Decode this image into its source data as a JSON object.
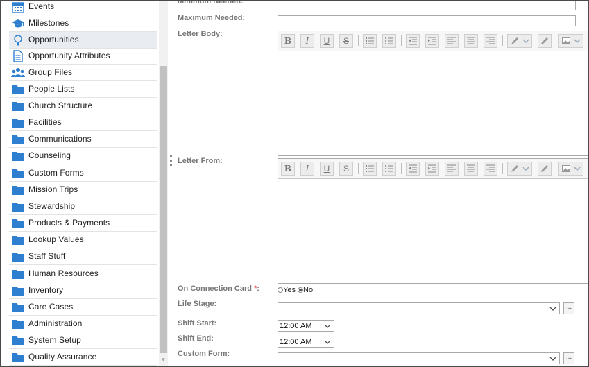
{
  "sidebar": {
    "items": [
      {
        "label": "Events",
        "icon": "calendar-icon"
      },
      {
        "label": "Milestones",
        "icon": "graduation-cap-icon"
      },
      {
        "label": "Opportunities",
        "icon": "lightbulb-icon",
        "active": true
      },
      {
        "label": "Opportunity Attributes",
        "icon": "document-icon"
      },
      {
        "label": "Group Files",
        "icon": "people-group-icon"
      },
      {
        "label": "People Lists",
        "icon": "folder-icon"
      },
      {
        "label": "Church Structure",
        "icon": "folder-icon"
      },
      {
        "label": "Facilities",
        "icon": "folder-icon"
      },
      {
        "label": "Communications",
        "icon": "folder-icon"
      },
      {
        "label": "Counseling",
        "icon": "folder-icon"
      },
      {
        "label": "Custom Forms",
        "icon": "folder-icon"
      },
      {
        "label": "Mission Trips",
        "icon": "folder-icon"
      },
      {
        "label": "Stewardship",
        "icon": "folder-icon"
      },
      {
        "label": "Products & Payments",
        "icon": "folder-icon"
      },
      {
        "label": "Lookup Values",
        "icon": "folder-icon"
      },
      {
        "label": "Staff Stuff",
        "icon": "folder-icon"
      },
      {
        "label": "Human Resources",
        "icon": "folder-icon"
      },
      {
        "label": "Inventory",
        "icon": "folder-icon"
      },
      {
        "label": "Care Cases",
        "icon": "folder-icon"
      },
      {
        "label": "Administration",
        "icon": "folder-icon"
      },
      {
        "label": "System Setup",
        "icon": "folder-icon"
      },
      {
        "label": "Quality Assurance",
        "icon": "folder-icon"
      }
    ]
  },
  "form": {
    "minimum_needed_label": "Minimum Needed:",
    "maximum_needed_label": "Maximum Needed:",
    "minimum_needed_value": "",
    "maximum_needed_value": "",
    "letter_body_label": "Letter Body:",
    "letter_from_label": "Letter From:",
    "on_connection_card_label": "On Connection Card",
    "required_marker": "*",
    "label_colon": ":",
    "yes_label": "Yes",
    "no_label": "No",
    "on_connection_card_value": "No",
    "life_stage_label": "Life Stage:",
    "life_stage_value": "",
    "shift_start_label": "Shift Start:",
    "shift_start_value": "12:00 AM",
    "shift_end_label": "Shift End:",
    "shift_end_value": "12:00 AM",
    "custom_form_label": "Custom Form:",
    "custom_form_value": "",
    "ellipsis_label": "..."
  },
  "toolbar": {
    "bold": "B",
    "italic": "I",
    "underline": "U",
    "strike": "S"
  },
  "colors": {
    "label_gray": "#777777",
    "required_red": "#e24b4b",
    "folder_blue": "#2f7fd0",
    "active_bg": "#e9edf2"
  }
}
